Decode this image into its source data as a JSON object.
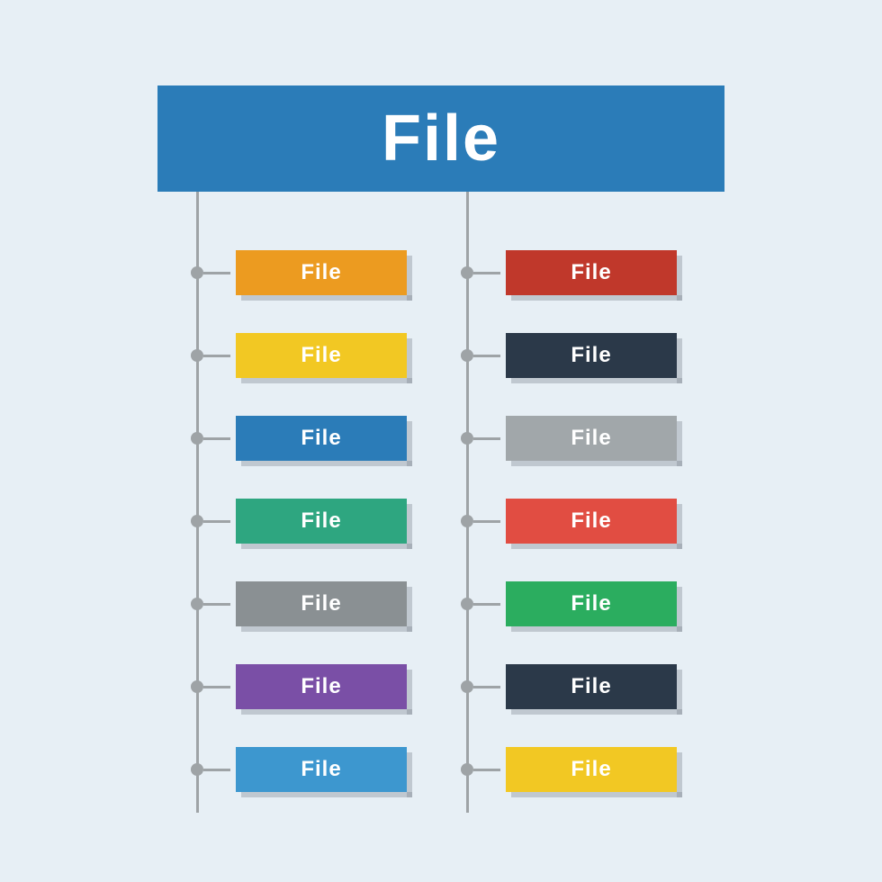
{
  "root": {
    "label": "File",
    "color": "#2b7cb8"
  },
  "left": [
    {
      "label": "File",
      "color": "#ec9b20"
    },
    {
      "label": "File",
      "color": "#f2c823"
    },
    {
      "label": "File",
      "color": "#2b7cb8"
    },
    {
      "label": "File",
      "color": "#2ea680"
    },
    {
      "label": "File",
      "color": "#8a9093"
    },
    {
      "label": "File",
      "color": "#7a4fa6"
    },
    {
      "label": "File",
      "color": "#3d97cf"
    }
  ],
  "right": [
    {
      "label": "File",
      "color": "#c0382b"
    },
    {
      "label": "File",
      "color": "#2b3949"
    },
    {
      "label": "File",
      "color": "#a1a7aa"
    },
    {
      "label": "File",
      "color": "#e14d42"
    },
    {
      "label": "File",
      "color": "#2bad5f"
    },
    {
      "label": "File",
      "color": "#2b3949"
    },
    {
      "label": "File",
      "color": "#f2c823"
    }
  ]
}
